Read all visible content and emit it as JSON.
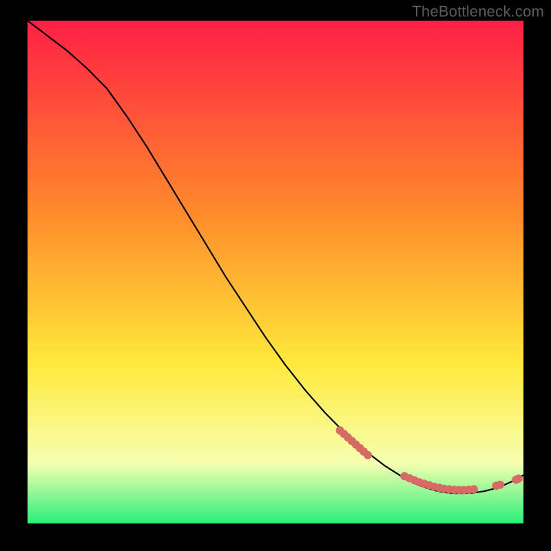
{
  "watermark": "TheBottleneck.com",
  "colors": {
    "gradient_top": "#ff1f45",
    "gradient_mid1": "#ff8a2a",
    "gradient_mid2": "#ffe93a",
    "gradient_mid3": "#f6ffb0",
    "gradient_bottom": "#2bf07a",
    "line": "#000000",
    "marker": "#d86a65",
    "background": "#000000"
  },
  "chart_data": {
    "type": "line",
    "title": "",
    "xlabel": "",
    "ylabel": "",
    "xlim": [
      0,
      100
    ],
    "ylim": [
      0,
      100
    ],
    "series": [
      {
        "name": "curve",
        "x": [
          0,
          4,
          8,
          12,
          16,
          20,
          24,
          28,
          32,
          36,
          40,
          44,
          48,
          52,
          56,
          60,
          64,
          68,
          72,
          76,
          78,
          80,
          82,
          84,
          86,
          88,
          90,
          92,
          94,
          96,
          98,
          100
        ],
        "y": [
          100,
          97,
          94,
          90.5,
          86.5,
          81,
          75,
          68.5,
          62,
          55.5,
          49,
          43,
          37,
          31.5,
          26.5,
          22,
          18,
          14.5,
          11.5,
          9,
          8,
          7.2,
          6.6,
          6.2,
          6,
          6,
          6.1,
          6.4,
          6.9,
          7.6,
          8.5,
          9.6
        ]
      }
    ],
    "markers": [
      {
        "x": 63.0,
        "y": 18.5
      },
      {
        "x": 63.8,
        "y": 17.8
      },
      {
        "x": 64.6,
        "y": 17.1
      },
      {
        "x": 65.4,
        "y": 16.4
      },
      {
        "x": 66.2,
        "y": 15.7
      },
      {
        "x": 67.0,
        "y": 15.0
      },
      {
        "x": 67.8,
        "y": 14.3
      },
      {
        "x": 68.6,
        "y": 13.6
      },
      {
        "x": 76.0,
        "y": 9.4
      },
      {
        "x": 77.0,
        "y": 9.0
      },
      {
        "x": 78.0,
        "y": 8.6
      },
      {
        "x": 79.0,
        "y": 8.2
      },
      {
        "x": 80.0,
        "y": 7.9
      },
      {
        "x": 81.0,
        "y": 7.6
      },
      {
        "x": 82.0,
        "y": 7.3
      },
      {
        "x": 83.0,
        "y": 7.1
      },
      {
        "x": 84.0,
        "y": 6.9
      },
      {
        "x": 85.0,
        "y": 6.8
      },
      {
        "x": 86.0,
        "y": 6.7
      },
      {
        "x": 87.0,
        "y": 6.65
      },
      {
        "x": 88.0,
        "y": 6.65
      },
      {
        "x": 89.0,
        "y": 6.7
      },
      {
        "x": 90.0,
        "y": 6.8
      },
      {
        "x": 94.5,
        "y": 7.5
      },
      {
        "x": 95.3,
        "y": 7.7
      },
      {
        "x": 98.5,
        "y": 8.7
      },
      {
        "x": 99.0,
        "y": 8.9
      }
    ]
  }
}
